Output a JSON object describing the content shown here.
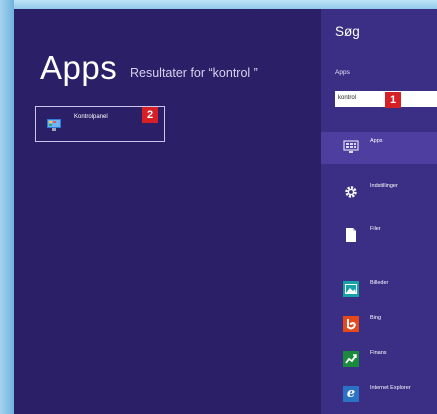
{
  "results": {
    "title": "Apps",
    "subtitle": "Resultater for “kontrol ”",
    "tile": {
      "label": "Kontrolpanel",
      "icon": "control-panel-icon"
    }
  },
  "search_pane": {
    "title": "Søg",
    "scope": "Apps",
    "query": "kontrol",
    "categories": [
      {
        "label": "Apps",
        "icon": "apps-icon",
        "selected": true
      },
      {
        "label": "Indstillinger",
        "icon": "gear-icon"
      },
      {
        "label": "Filer",
        "icon": "file-icon"
      }
    ],
    "apps": [
      {
        "label": "Billeder",
        "icon": "photos-icon"
      },
      {
        "label": "Bing",
        "icon": "bing-icon"
      },
      {
        "label": "Finans",
        "icon": "finance-icon"
      },
      {
        "label": "Internet Explorer",
        "icon": "internet-explorer-icon"
      }
    ]
  },
  "annotations": {
    "badge_1": "1",
    "badge_2": "2"
  }
}
